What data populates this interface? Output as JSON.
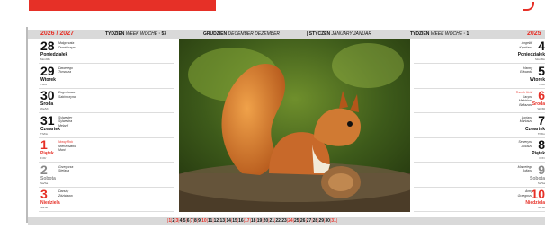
{
  "colors": {
    "accent": "#e63027",
    "band": "#d9d9d9"
  },
  "header": {
    "year_left": "2026 / 2027",
    "year_right": "2025",
    "week_left_label": "TYDZIEŃ",
    "week_left_sub": "WEEK WOCHE",
    "week_left_num": "53",
    "month_left": "GRUDZIEŃ",
    "month_left_sub": "DECEMBER DEZEMBER",
    "month_right": "STYCZEŃ",
    "month_right_sub": "JANUARY JANUAR",
    "week_right_label": "TYDZIEŃ",
    "week_right_sub": "WEEK WOCHE",
    "week_right_num": "1"
  },
  "left_days": [
    {
      "num": "28",
      "name": "Poniedziałek",
      "sub": "Mon/Mo",
      "names": [
        "Małgorzata",
        "Dominiczyna"
      ]
    },
    {
      "num": "29",
      "name": "Wtorek",
      "sub": "Tu/Di",
      "names": [
        "Dawerego",
        "Tomasza"
      ]
    },
    {
      "num": "30",
      "name": "Środa",
      "sub": "We/Mi",
      "names": [
        "Eugeniusza",
        "Sabiniczyna"
      ]
    },
    {
      "num": "31",
      "name": "Czwartek",
      "sub": "Th/Do",
      "names": [
        "Sylwester",
        "Sylwestra",
        "Melanii"
      ]
    },
    {
      "num": "1",
      "name": "Piątek",
      "sub": "Fr/Fr",
      "names": [
        "Nowy Rok",
        "Mieczysława",
        "Mani"
      ],
      "style": "red"
    },
    {
      "num": "2",
      "name": "Sobota",
      "sub": "Sa/Sa",
      "names": [
        "Grzegorza",
        "Stefana"
      ],
      "style": "grey"
    },
    {
      "num": "3",
      "name": "Niedziela",
      "sub": "Su/So",
      "names": [
        "Danuty",
        "Zdzisława"
      ],
      "style": "red"
    }
  ],
  "right_days": [
    {
      "num": "4",
      "name": "Poniedziałek",
      "sub": "Mon/Mo",
      "names": [
        "Angeliki",
        "Krystiana"
      ]
    },
    {
      "num": "5",
      "name": "Wtorek",
      "sub": "Tu/Di",
      "names": [
        "Hanny",
        "Edwarda"
      ]
    },
    {
      "num": "6",
      "name": "Środa",
      "sub": "We/Mi",
      "names": [
        "Trzech Króli",
        "Kacpra",
        "Melchiora",
        "Baltazara"
      ],
      "style": "red"
    },
    {
      "num": "7",
      "name": "Czwartek",
      "sub": "Th/Do",
      "names": [
        "Lucjana",
        "Mariusza"
      ]
    },
    {
      "num": "8",
      "name": "Piątek",
      "sub": "Fr/Fr",
      "names": [
        "Seweryna",
        "Juliusza"
      ]
    },
    {
      "num": "9",
      "name": "Sobota",
      "sub": "Sa/Sa",
      "names": [
        "Marcelego",
        "Juliana"
      ],
      "style": "grey"
    },
    {
      "num": "10",
      "name": "Niedziela",
      "sub": "Su/So",
      "names": [
        "Anny",
        "Grzegorza"
      ],
      "style": "red"
    }
  ],
  "month_strip": [
    "1",
    "2",
    "3",
    "4",
    "5",
    "6",
    "7",
    "8",
    "9",
    "10",
    "11",
    "12",
    "13",
    "14",
    "15",
    "16",
    "17",
    "18",
    "19",
    "20",
    "21",
    "22",
    "23",
    "24",
    "25",
    "26",
    "27",
    "28",
    "29",
    "30",
    "31"
  ],
  "month_strip_red": [
    "1",
    "3",
    "10",
    "17",
    "24",
    "31"
  ],
  "image_icon": "squirrel-photo"
}
